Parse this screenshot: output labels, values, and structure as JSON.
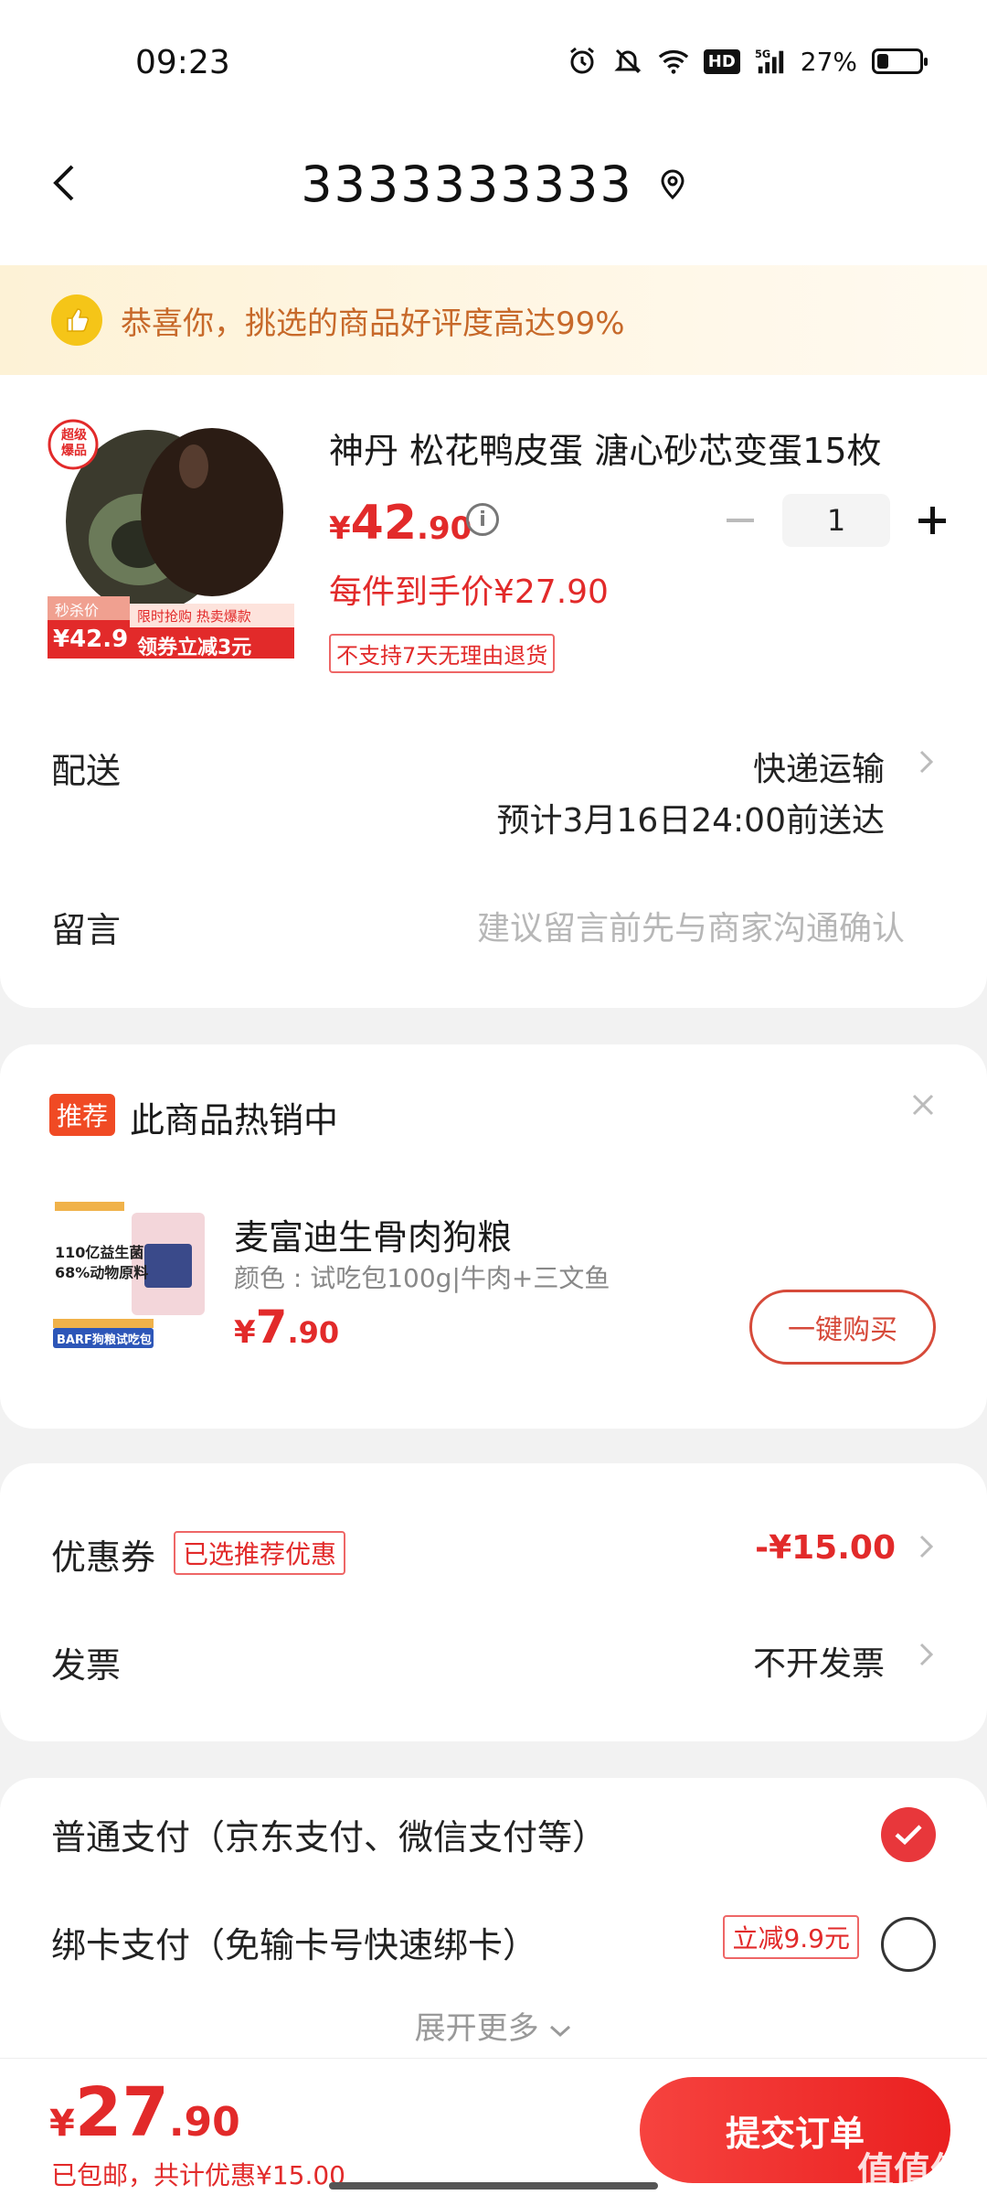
{
  "status_bar": {
    "time": "09:23",
    "network": "5G",
    "battery": "27%",
    "battery_level": 0.27,
    "icons": [
      "alarm-icon",
      "mute-icon",
      "wifi-icon",
      "hd-icon",
      "signal-icon",
      "battery-icon"
    ]
  },
  "header": {
    "title": "3333333333",
    "back_icon": "chevron-left-icon",
    "location_icon": "location-pin-icon"
  },
  "banner": {
    "text": "恭喜你，挑选的商品好评度高达99%",
    "icon": "thumbs-up-icon"
  },
  "product": {
    "title": "神丹 松花鸭皮蛋 溏心砂芯变蛋15枚",
    "price_yen": "¥",
    "price_int": "42",
    "price_dec": ".90",
    "each_price": "每件到手价¥27.90",
    "no_return": "不支持7天无理由退货",
    "quantity": "1",
    "image": {
      "badge_top": "超级",
      "badge_bottom": "爆品",
      "seckill_label": "秒杀价",
      "seckill_price": "¥42.9",
      "promo_line1": "限时抢购 热卖爆款",
      "promo_line2": "领券立减3元"
    }
  },
  "delivery": {
    "label": "配送",
    "value": "快递运输",
    "eta": "预计3月16日24:00前送达"
  },
  "message": {
    "label": "留言",
    "placeholder": "建议留言前先与商家沟通确认"
  },
  "recommend": {
    "badge": "推荐",
    "title": "此商品热销中",
    "item_name": "麦富迪生骨肉狗粮",
    "item_spec": "颜色 : 试吃包100g|牛肉+三文鱼",
    "price_yen": "¥",
    "price_int": "7",
    "price_dec": ".90",
    "buy_label": "一键购买",
    "image": {
      "line1": "110亿益生菌",
      "line2": "68%动物原料",
      "tag": "BARF狗粮试吃包"
    }
  },
  "coupon": {
    "label": "优惠券",
    "tag": "已选推荐优惠",
    "amount": "-¥15.00"
  },
  "invoice": {
    "label": "发票",
    "value": "不开发票"
  },
  "payment": {
    "option1": "普通支付（京东支付、微信支付等）",
    "option2": "绑卡支付（免输卡号快速绑卡）",
    "option2_tag": "立减9.9元",
    "expand": "展开更多"
  },
  "bottom": {
    "yen": "¥",
    "total_int": "27",
    "total_dec": ".90",
    "note": "已包邮，共计优惠¥15.00",
    "submit": "提交订单",
    "watermark": "值值值"
  },
  "colors": {
    "accent_red": "#e22a2a",
    "button_red": "#ea2020",
    "banner_orange": "#c7692a",
    "banner_bg": "#fdf2d6"
  }
}
